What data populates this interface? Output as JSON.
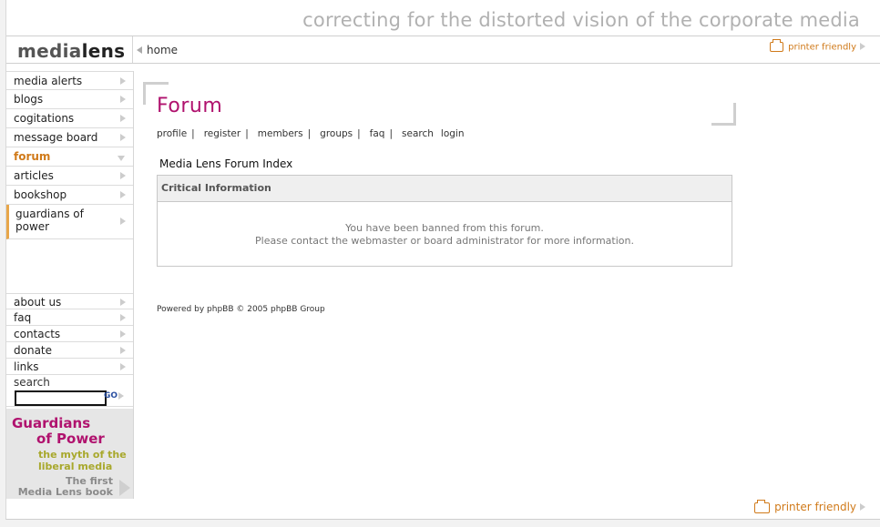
{
  "header": {
    "tagline": "correcting for the distorted vision of the corporate media",
    "logo_media": "media",
    "logo_lens": "lens",
    "home_label": "home",
    "printer_friendly_label": "printer friendly"
  },
  "sidebar": {
    "items": [
      {
        "label": "media alerts"
      },
      {
        "label": "blogs"
      },
      {
        "label": "cogitations"
      },
      {
        "label": "message board"
      },
      {
        "label": "forum"
      },
      {
        "label": "articles"
      },
      {
        "label": "bookshop"
      },
      {
        "label": "guardians of power"
      }
    ],
    "secondary": [
      {
        "label": "about us"
      },
      {
        "label": "faq"
      },
      {
        "label": "contacts"
      },
      {
        "label": "donate"
      },
      {
        "label": "links"
      }
    ],
    "search_label": "search",
    "search_go": "GO",
    "search_value": "",
    "promo": {
      "title_line1": "Guardians",
      "title_line2": "of Power",
      "subtitle_line1": "the myth of the",
      "subtitle_line2": "liberal media",
      "footer_line1": "The first",
      "footer_line2": "Media Lens book"
    }
  },
  "main": {
    "title": "Forum",
    "links": [
      "profile",
      "register",
      "members",
      "groups",
      "faq",
      "search",
      "login"
    ],
    "index_title": "Media Lens Forum Index",
    "panel_title": "Critical Information",
    "message_line1": "You have been banned from this forum.",
    "message_line2": "Please contact the webmaster or board administrator for more information.",
    "powered_by": "Powered by phpBB © 2005 phpBB Group"
  },
  "footer": {
    "printer_friendly_label": "printer friendly"
  },
  "colors": {
    "accent": "#b0126e",
    "active": "#d07a1a",
    "promo_sub": "#a8a82c"
  }
}
